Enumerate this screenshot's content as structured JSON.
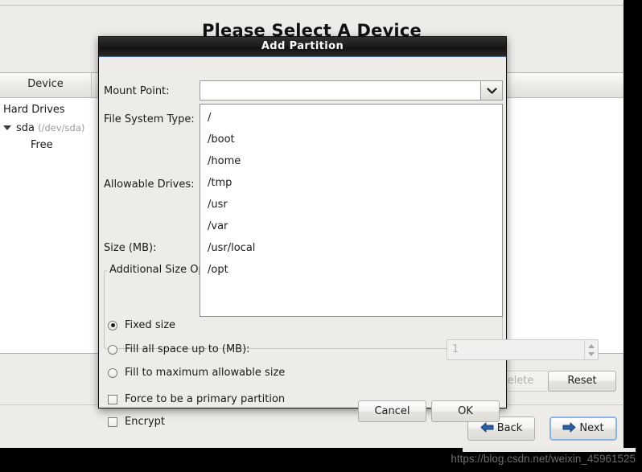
{
  "background_window": {
    "page_title": "Please Select A Device",
    "device_table": {
      "columns": [
        "Device"
      ],
      "rows": [
        {
          "label": "Hard Drives",
          "sub": "",
          "indent": 0,
          "expander": false
        },
        {
          "label": "sda",
          "sub": "(/dev/sda)",
          "indent": 1,
          "expander": true
        },
        {
          "label": "Free",
          "sub": "",
          "indent": 2,
          "expander": false
        }
      ]
    },
    "action_buttons": [
      {
        "label": "Delete",
        "enabled": false
      },
      {
        "label": "Reset",
        "enabled": true
      }
    ],
    "nav_buttons": [
      {
        "label": "Back",
        "icon": "arrow-left-icon",
        "default": false
      },
      {
        "label": "Next",
        "icon": "arrow-right-icon",
        "default": true
      }
    ]
  },
  "dialog": {
    "title": "Add Partition",
    "fields": {
      "mount_point_label": "Mount Point:",
      "mount_point_value": "",
      "mount_point_placeholder": "",
      "file_system_type_label": "File System Type:",
      "allowable_drives_label": "Allowable Drives:",
      "size_mb_label": "Size (MB):"
    },
    "mount_point_options": [
      "/",
      "/boot",
      "/home",
      "/tmp",
      "/usr",
      "/var",
      "/usr/local",
      "/opt"
    ],
    "additional_size_options": {
      "legend": "Additional Size Options",
      "radios": [
        {
          "label": "Fixed size",
          "checked": true
        },
        {
          "label": "Fill all space up to (MB):",
          "checked": false
        },
        {
          "label": "Fill to maximum allowable size",
          "checked": false
        }
      ],
      "fill_size_value": "1",
      "fill_size_enabled": false
    },
    "checkboxes": [
      {
        "label": "Force to be a primary partition",
        "checked": false
      },
      {
        "label": "Encrypt",
        "checked": false
      }
    ],
    "buttons": [
      {
        "label": "Cancel"
      },
      {
        "label": "OK"
      }
    ]
  },
  "watermark": {
    "text": "https://blog.csdn.net/weixin_45961525"
  },
  "colors": {
    "window_bg": "#edece9",
    "dialog_titlebar": "#1d1d1c",
    "titlebar_accent": "#4a6c9b",
    "default_button_focus": "#8cb4e2",
    "arrow_blue": "#2b5fa8",
    "list_bg": "#ffffff"
  }
}
